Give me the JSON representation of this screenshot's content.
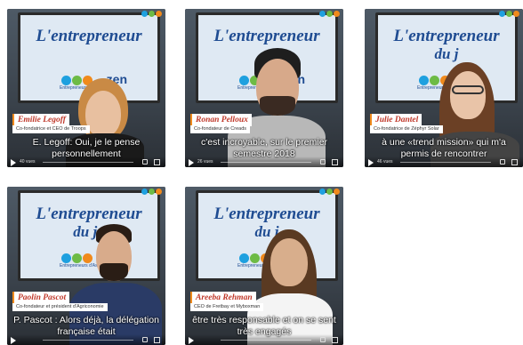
{
  "videos": [
    {
      "screen_title": "L'entrepreneur",
      "screen_title_line2": "",
      "screen_logo_text": "Entrepreneurs d'Assurances",
      "screen_logo_suffix": "zen",
      "name": "Emilie Legoff",
      "role": "Co-fondatrice et CEO de Troops",
      "subtitle": "E. Legoff: Oui, je le pense personnellement",
      "views": "40 vues",
      "skin": "#e8c0a0",
      "hair": "#c98a45",
      "shirt": "#1a1a1a"
    },
    {
      "screen_title": "L'entrepreneur",
      "screen_title_line2": "",
      "screen_logo_text": "Entrepreneurs d'Assurances",
      "screen_logo_suffix": "zen",
      "name": "Ronan Pelloux",
      "role": "Co-fondateur de Creads",
      "subtitle": "c'est incroyable, sur le premier semestre 2018",
      "views": "26 vues",
      "skin": "#d7a98a",
      "hair": "#1e1e1e",
      "shirt": "#b8b8b8"
    },
    {
      "screen_title": "L'entrepreneur",
      "screen_title_line2": "du j",
      "screen_logo_text": "Entrepreneurs d'Assurances",
      "screen_logo_suffix": "",
      "name": "Julie Dantel",
      "role": "Co-fondatrice de Zéphyr Solar",
      "subtitle": "à une «trend mission» qui m'a permis de rencontrer",
      "views": "46 vues",
      "skin": "#e9c4a8",
      "hair": "#6b4025",
      "shirt": "#444444"
    },
    {
      "screen_title": "L'entrepreneur",
      "screen_title_line2": "du jo",
      "screen_logo_text": "Entrepreneurs d'Assurances",
      "screen_logo_suffix": "",
      "name": "Paolin Pascot",
      "role": "Co-fondateur et président d'Agriconomie",
      "subtitle": "P. Pascot : Alors déjà, la délégation française était",
      "views": "",
      "skin": "#d8ab8b",
      "hair": "#2a1d15",
      "shirt": "#2a3b66"
    },
    {
      "screen_title": "L'entrepreneur",
      "screen_title_line2": "du j",
      "screen_logo_text": "Entrepreneurs d'Assurances",
      "screen_logo_suffix": "",
      "name": "Areeba Rehman",
      "role": "CEO de Fretbay et Myboxman",
      "subtitle": "être très responsable et on se sent très engagés",
      "views": "",
      "skin": "#d8ae8c",
      "hair": "#5a3a22",
      "shirt": "#f4f4f4"
    }
  ],
  "icons": {
    "play": "play-icon",
    "volume": "volume-icon",
    "fullscreen": "fullscreen-icon"
  }
}
